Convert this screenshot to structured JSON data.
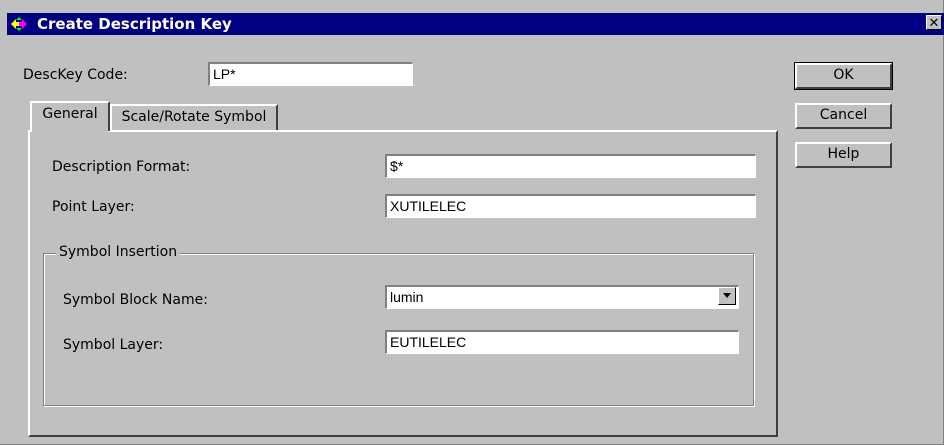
{
  "window": {
    "title": "Create Description Key",
    "close_glyph": "✕"
  },
  "desckey": {
    "label": "DescKey Code:",
    "value": "LP*"
  },
  "buttons": {
    "ok": "OK",
    "cancel": "Cancel",
    "help": "Help"
  },
  "tabs": [
    {
      "label": "General",
      "active": true
    },
    {
      "label": "Scale/Rotate Symbol",
      "active": false
    }
  ],
  "general": {
    "description_format_label": "Description Format:",
    "description_format_value": "$*",
    "point_layer_label": "Point Layer:",
    "point_layer_value": "XUTILELEC"
  },
  "symbol_insertion": {
    "group_title": "Symbol Insertion",
    "block_name_label": "Symbol Block Name:",
    "block_name_value": "lumin",
    "symbol_layer_label": "Symbol Layer:",
    "symbol_layer_value": "EUTILELEC"
  },
  "colors": {
    "titlebar": "#000080",
    "face": "#c0c0c0"
  },
  "icons": {
    "app": "diamond-arrows-icon",
    "dropdown": "chevron-down-icon"
  }
}
